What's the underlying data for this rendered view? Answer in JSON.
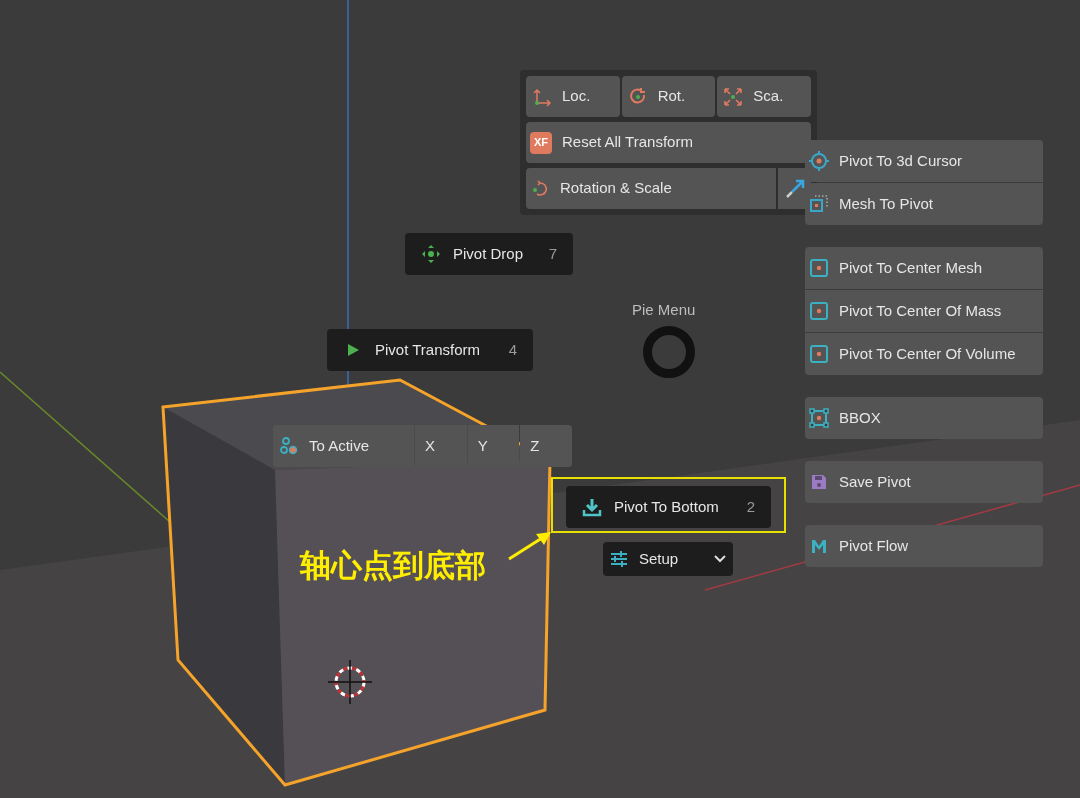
{
  "viewport": {
    "pie_label": "Pie Menu"
  },
  "transform_panel": {
    "axes": [
      {
        "label": "Loc.",
        "kind": "location"
      },
      {
        "label": "Rot.",
        "kind": "rotation"
      },
      {
        "label": "Sca.",
        "kind": "scale"
      }
    ],
    "reset": {
      "label": "Reset All Transform",
      "icon_text": "XF"
    },
    "rotation_scale": {
      "label": "Rotation & Scale"
    }
  },
  "pie_items": [
    {
      "label": "Pivot Drop",
      "hotkey": "7",
      "kind": "drop"
    },
    {
      "label": "Pivot Transform",
      "hotkey": "4",
      "kind": "play"
    },
    {
      "label": "Pivot To Bottom",
      "hotkey": "2",
      "kind": "bottom"
    }
  ],
  "to_active": {
    "label": "To Active",
    "axes": [
      "X",
      "Y",
      "Z"
    ]
  },
  "setup": {
    "label": "Setup"
  },
  "side_groups": [
    [
      {
        "label": "Pivot To 3d Cursor",
        "kind": "cursor"
      },
      {
        "label": "Mesh To Pivot",
        "kind": "mesh"
      }
    ],
    [
      {
        "label": "Pivot To Center Mesh",
        "kind": "center"
      },
      {
        "label": "Pivot To Center Of Mass",
        "kind": "center"
      },
      {
        "label": "Pivot To Center Of Volume",
        "kind": "center"
      }
    ],
    [
      {
        "label": "BBOX",
        "kind": "bbox"
      }
    ],
    [
      {
        "label": "Save Pivot",
        "kind": "save"
      }
    ],
    [
      {
        "label": "Pivot Flow",
        "kind": "flow"
      }
    ]
  ],
  "annotation": {
    "text": "轴心点到底部"
  }
}
